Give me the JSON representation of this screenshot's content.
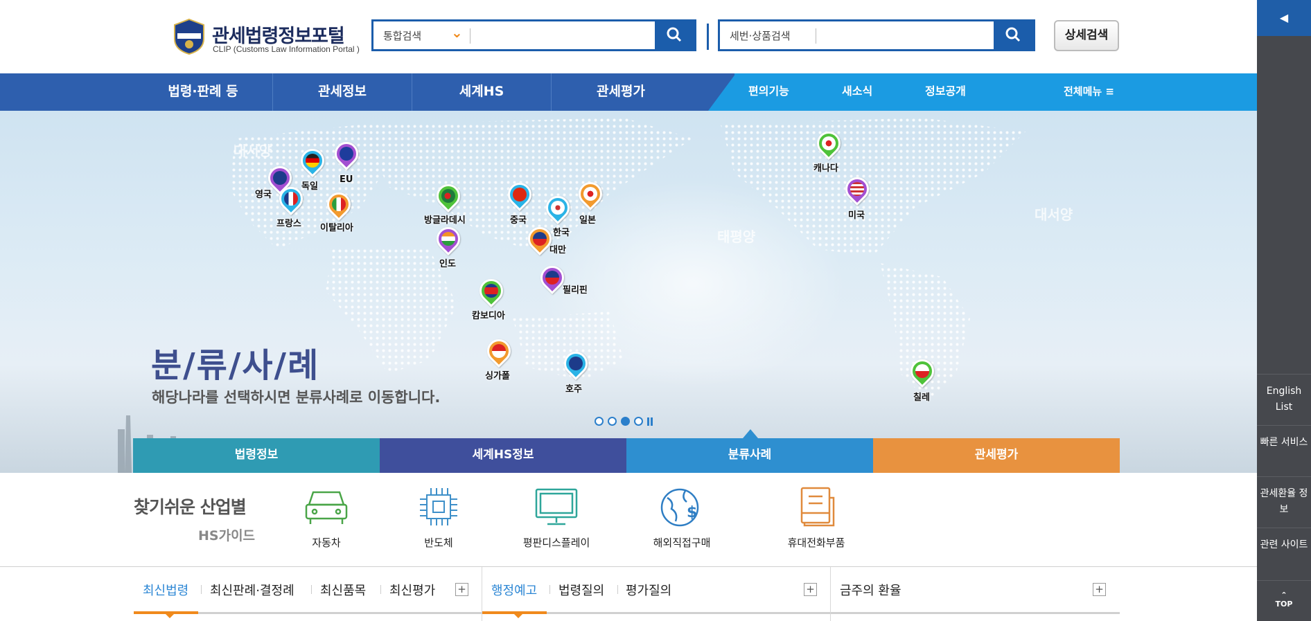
{
  "header": {
    "logo_title": "관세법령정보포털",
    "logo_sub": "CLIP (Customs Law Information Portal )",
    "search1_selected": "통합검색",
    "search2_selected": "세번·상품검색",
    "advanced_search": "상세검색"
  },
  "nav": {
    "main": [
      "법령·판례 등",
      "관세정보",
      "세계HS",
      "관세평가"
    ],
    "sub": [
      "편의기능",
      "새소식",
      "정보공개"
    ],
    "all_menu": "전체메뉴 ≡"
  },
  "hero": {
    "oceans": [
      "대서양",
      "대서양",
      "태평양"
    ],
    "title": "분/류/사/례",
    "description": "해당나라를 선택하시면 분류사례로 이동합니다.",
    "pins": [
      {
        "label": "영국",
        "color": "#a34fd1"
      },
      {
        "label": "독일",
        "color": "#2bb3e6"
      },
      {
        "label": "EU",
        "color": "#a34fd1"
      },
      {
        "label": "프랑스",
        "color": "#2bb3e6"
      },
      {
        "label": "이탈리아",
        "color": "#f29a2e"
      },
      {
        "label": "방글라데시",
        "color": "#4fc23a"
      },
      {
        "label": "인도",
        "color": "#a34fd1"
      },
      {
        "label": "중국",
        "color": "#2bb3e6"
      },
      {
        "label": "한국",
        "color": "#2bb3e6"
      },
      {
        "label": "일본",
        "color": "#f29a2e"
      },
      {
        "label": "대만",
        "color": "#f29a2e"
      },
      {
        "label": "필리핀",
        "color": "#a34fd1"
      },
      {
        "label": "캄보디아",
        "color": "#4fc23a"
      },
      {
        "label": "싱가폴",
        "color": "#f29a2e"
      },
      {
        "label": "호주",
        "color": "#2bb3e6"
      },
      {
        "label": "캐나다",
        "color": "#4fc23a"
      },
      {
        "label": "미국",
        "color": "#a34fd1"
      },
      {
        "label": "칠레",
        "color": "#4fc23a"
      }
    ],
    "tabs": [
      {
        "label": "법령정보",
        "color": "#2f9bb3"
      },
      {
        "label": "세계HS정보",
        "color": "#3f4f9c"
      },
      {
        "label": "분류사례",
        "color": "#2e8fd0"
      },
      {
        "label": "관세평가",
        "color": "#e8923f"
      }
    ]
  },
  "industry": {
    "title": "찾기쉬운 산업별",
    "subtitle": "HS가이드",
    "items": [
      {
        "label": "자동차",
        "color": "#4aa548"
      },
      {
        "label": "반도체",
        "color": "#3d8fc9"
      },
      {
        "label": "평판디스플레이",
        "color": "#2ea69a"
      },
      {
        "label": "해외직접구매",
        "color": "#2f7ec4"
      },
      {
        "label": "휴대전화부품",
        "color": "#e08a3c"
      }
    ]
  },
  "bottom": {
    "col1": [
      "최신법령",
      "최신판례·결정례",
      "최신품목",
      "최신평가"
    ],
    "col2": [
      "행정예고",
      "법령질의",
      "평가질의"
    ],
    "col3": [
      "금주의 환율"
    ],
    "plus": "+"
  },
  "sidebar": {
    "toggle": "◀",
    "items": [
      "English List",
      "빠른 서비스",
      "관세환율 정보",
      "관련 사이트"
    ],
    "top": "TOP"
  }
}
